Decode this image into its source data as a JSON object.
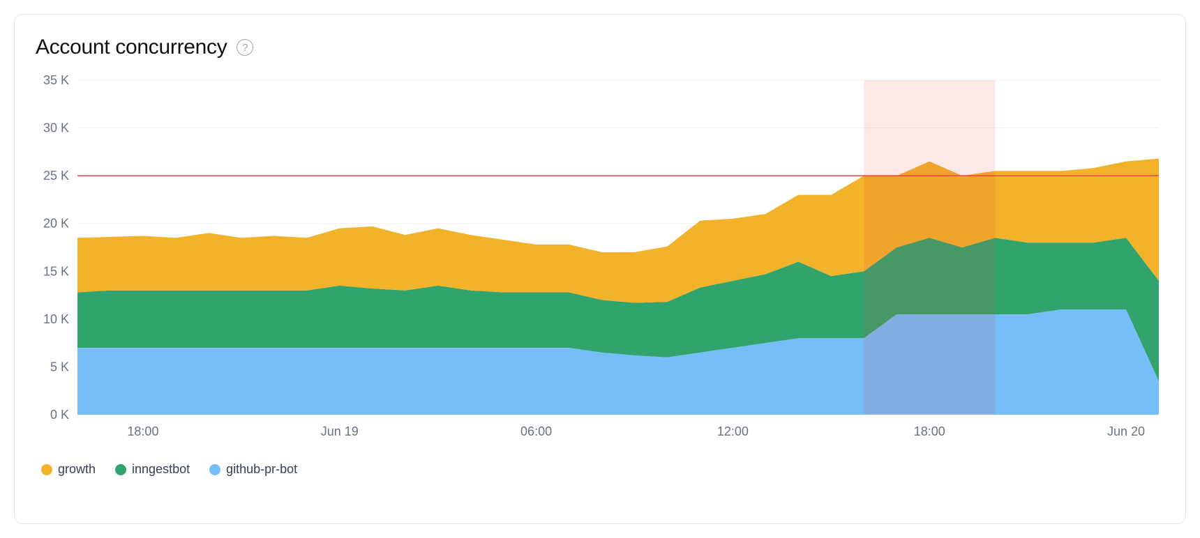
{
  "title": "Account concurrency",
  "legend": [
    {
      "name": "growth",
      "color": "#f2b22a"
    },
    {
      "name": "inngestbot",
      "color": "#30a46c"
    },
    {
      "name": "github-pr-bot",
      "color": "#75bef8"
    }
  ],
  "chart_data": {
    "type": "area",
    "title": "Account concurrency",
    "xlabel": "",
    "ylabel": "",
    "ylim": [
      0,
      35
    ],
    "ytick_labels": [
      "0 K",
      "5 K",
      "10 K",
      "15 K",
      "20 K",
      "25 K",
      "30 K",
      "35 K"
    ],
    "x": [
      0,
      1,
      2,
      3,
      4,
      5,
      6,
      7,
      8,
      9,
      10,
      11,
      12,
      13,
      14,
      15,
      16,
      17,
      18,
      19,
      20,
      21,
      22,
      23,
      24,
      25,
      26,
      27,
      28,
      29,
      30,
      31,
      32,
      33
    ],
    "xtick_positions": [
      2,
      8,
      14,
      20,
      26,
      32
    ],
    "xtick_labels": [
      "18:00",
      "Jun 19",
      "06:00",
      "12:00",
      "18:00",
      "Jun 20"
    ],
    "threshold": 25,
    "highlight_range": [
      24,
      28
    ],
    "series": [
      {
        "name": "github-pr-bot",
        "color": "#75bef8",
        "values": [
          7,
          7,
          7,
          7,
          7,
          7,
          7,
          7,
          7,
          7,
          7,
          7,
          7,
          7,
          7,
          7,
          6.5,
          6.2,
          6,
          6.5,
          7,
          7.5,
          8,
          8,
          8,
          10.5,
          10.5,
          10.5,
          10.5,
          10.5,
          11,
          11,
          11,
          3.5
        ]
      },
      {
        "name": "inngestbot",
        "color": "#30a46c",
        "values": [
          5.8,
          6,
          6,
          6,
          6,
          6,
          6,
          6,
          6.5,
          6.2,
          6,
          6.5,
          6,
          5.8,
          5.8,
          5.8,
          5.5,
          5.5,
          5.8,
          6.8,
          7,
          7.2,
          8,
          6.5,
          7,
          7,
          8,
          7,
          8,
          7.5,
          7,
          7,
          7.5,
          10.5
        ]
      },
      {
        "name": "growth",
        "color": "#f2b22a",
        "values": [
          5.7,
          5.6,
          5.7,
          5.5,
          6,
          5.5,
          5.7,
          5.5,
          6,
          6.5,
          5.8,
          6,
          5.8,
          5.5,
          5,
          5,
          5,
          5.3,
          5.8,
          7,
          6.5,
          6.3,
          7,
          8.5,
          10,
          7.5,
          8,
          7.5,
          7,
          7.5,
          7.5,
          7.8,
          8,
          12.8
        ]
      }
    ]
  }
}
